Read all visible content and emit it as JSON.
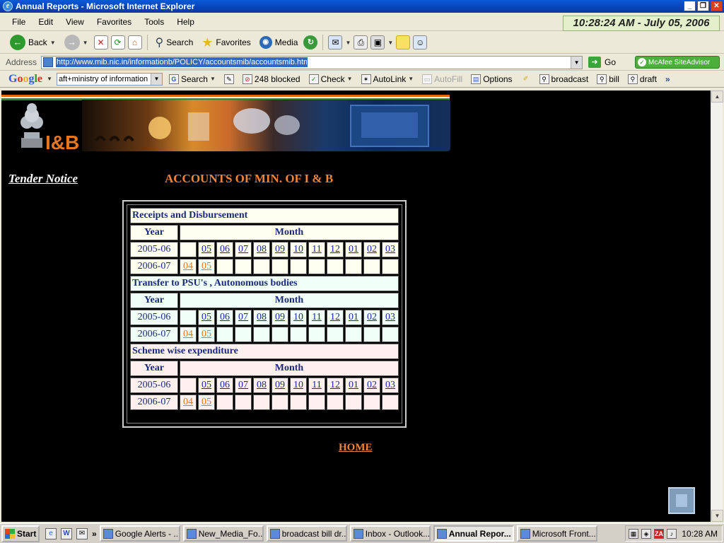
{
  "window": {
    "title": "Annual Reports - Microsoft Internet Explorer",
    "clock": "10:28:24 AM - July 05, 2006"
  },
  "menu": [
    "File",
    "Edit",
    "View",
    "Favorites",
    "Tools",
    "Help"
  ],
  "toolbar": {
    "back_label": "Back",
    "search_label": "Search",
    "favorites_label": "Favorites",
    "media_label": "Media"
  },
  "address": {
    "label": "Address",
    "url": "http://www.mib.nic.in/informationb/POLICY/accountsmib/accountsmib.htm",
    "go_label": "Go",
    "mcafee_label": "McAfee SiteAdvisor"
  },
  "google": {
    "logo": "Google",
    "query": "aft+ministry of information",
    "search_label": "Search",
    "blocked_label": "248 blocked",
    "check_label": "Check",
    "autolink_label": "AutoLink",
    "autofill_label": "AutoFill",
    "options_label": "Options",
    "buttons": [
      "broadcast",
      "bill",
      "draft"
    ]
  },
  "page": {
    "logo_text": "I&B",
    "tender_notice": "Tender Notice",
    "title": "ACCOUNTS OF MIN. OF I & B",
    "home": "HOME",
    "year_header": "Year",
    "month_header": "Month",
    "sections": [
      {
        "title": "Receipts and Disbursement",
        "rows": [
          {
            "year": "2005-06",
            "months": [
              "",
              "05",
              "06",
              "07",
              "08",
              "09",
              "10",
              "11",
              "12",
              "01",
              "02",
              "03"
            ]
          },
          {
            "year": "2006-07",
            "months": [
              "04",
              "05",
              "",
              "",
              "",
              "",
              "",
              "",
              "",
              "",
              "",
              ""
            ]
          }
        ]
      },
      {
        "title": "Transfer to PSU's , Autonomous bodies",
        "rows": [
          {
            "year": "2005-06",
            "months": [
              "",
              "05",
              "06",
              "07",
              "08",
              "09",
              "10",
              "11",
              "12",
              "01",
              "02",
              "03"
            ]
          },
          {
            "year": "2006-07",
            "months": [
              "04",
              "05",
              "",
              "",
              "",
              "",
              "",
              "",
              "",
              "",
              "",
              ""
            ]
          }
        ]
      },
      {
        "title": "Scheme wise expenditure",
        "rows": [
          {
            "year": "2005-06",
            "months": [
              "",
              "05",
              "06",
              "07",
              "08",
              "09",
              "10",
              "11",
              "12",
              "01",
              "02",
              "03"
            ]
          },
          {
            "year": "2006-07",
            "months": [
              "04",
              "05",
              "",
              "",
              "",
              "",
              "",
              "",
              "",
              "",
              "",
              ""
            ]
          }
        ]
      }
    ]
  },
  "taskbar": {
    "start_label": "Start",
    "tasks": [
      "Google Alerts - ...",
      "New_Media_Fo...",
      "broadcast bill dr...",
      "Inbox - Outlook...",
      "Annual Repor...",
      "Microsoft Front..."
    ],
    "active_task": "Annual Repor...",
    "time": "10:28 AM"
  }
}
